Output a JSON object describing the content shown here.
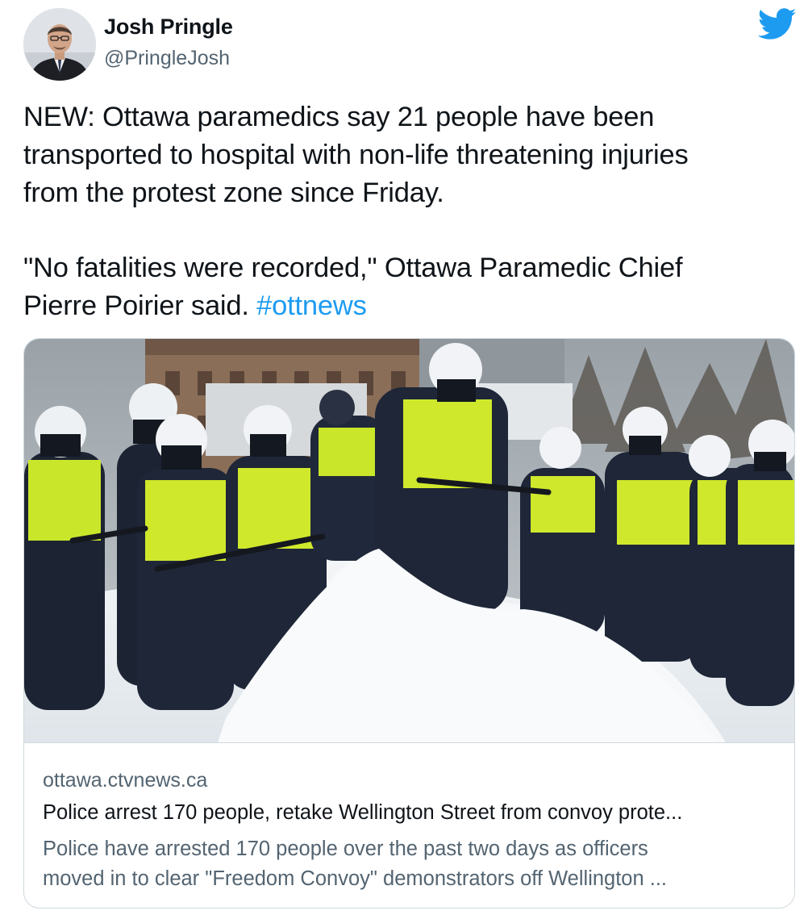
{
  "author": {
    "name": "Josh Pringle",
    "handle": "@PringleJosh",
    "avatar_icon": "profile-photo"
  },
  "brand_icon": "twitter-bird-icon",
  "colors": {
    "brand": "#1d9bf0",
    "text": "#0f1419",
    "secondary": "#536471",
    "border": "#cfd9de"
  },
  "tweet": {
    "para1": [
      "NEW: Ottawa paramedics say 21 people have been",
      "transported to hospital with non-life threatening injuries",
      "from the protest zone since Friday."
    ],
    "para2": [
      "\"No fatalities were recorded,\" Ottawa Paramedic Chief",
      "Pierre Poirier said. "
    ],
    "hashtag": "#ottnews"
  },
  "card": {
    "domain": "ottawa.ctvnews.ca",
    "title": "Police arrest 170 people, retake Wellington Street from convoy prote...",
    "description": [
      "Police have arrested 170 people over the past two days as officers",
      "moved in to clear \"Freedom Convoy\" demonstrators off Wellington ..."
    ]
  }
}
